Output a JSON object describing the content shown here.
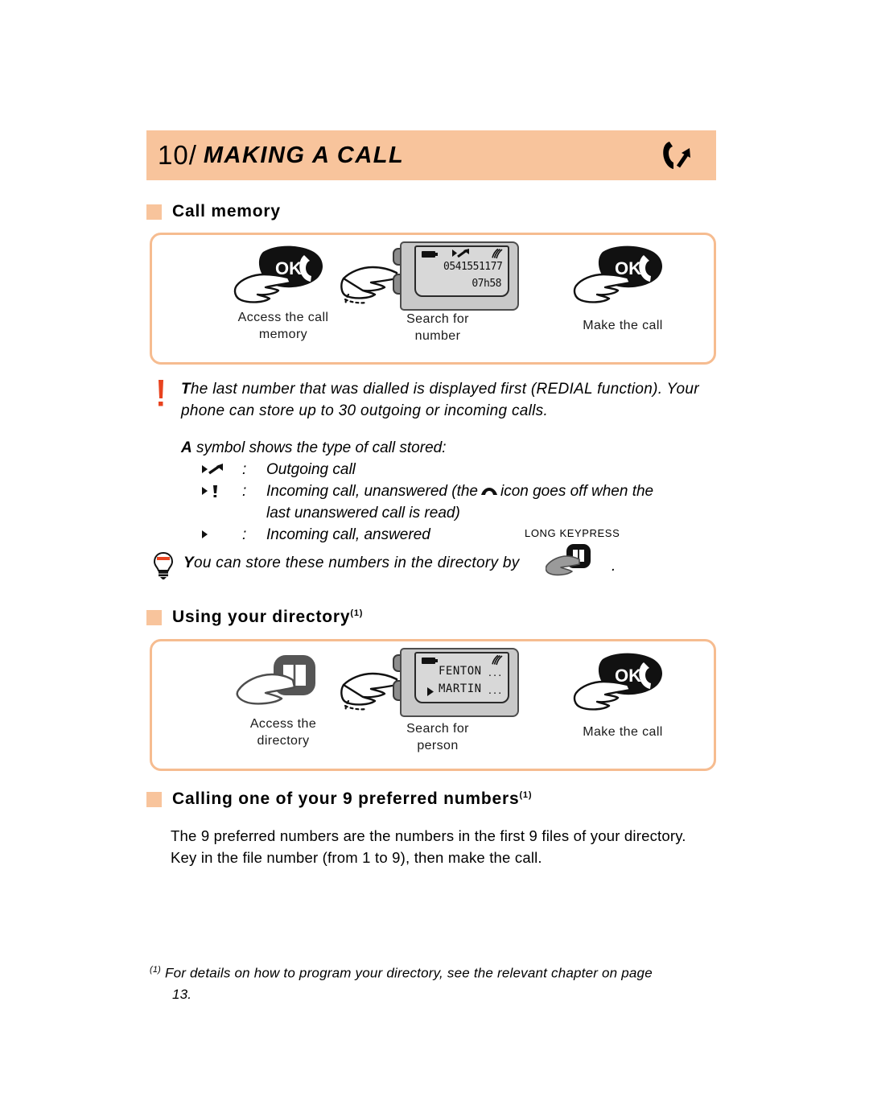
{
  "header": {
    "number": "10/",
    "title": "MAKING A CALL",
    "icon": "phone-outgoing-call-icon"
  },
  "sections": {
    "call_memory": {
      "heading": "Call memory",
      "steps": [
        {
          "caption_line1": "Access the call",
          "caption_line2": "memory",
          "icon": "hand-pressing-ok-key-icon"
        },
        {
          "caption_line1": "Search for",
          "caption_line2": "number",
          "icon": "hand-pressing-navigation-key-icon"
        },
        {
          "caption_line1": "Make the call",
          "caption_line2": "",
          "icon": "hand-pressing-ok-key-icon"
        }
      ],
      "phone_screen": {
        "number": "0541551177",
        "time": "07h58",
        "call_type_symbol": "outgoing-call-arrow-icon"
      }
    },
    "directory": {
      "heading": "Using your directory",
      "heading_footnote": "(1)",
      "steps": [
        {
          "caption_line1": "Access the",
          "caption_line2": "directory",
          "icon": "hand-pressing-directory-key-icon"
        },
        {
          "caption_line1": "Search for",
          "caption_line2": "person",
          "icon": "hand-pressing-navigation-key-icon"
        },
        {
          "caption_line1": "Make the call",
          "caption_line2": "",
          "icon": "hand-pressing-ok-key-icon"
        }
      ],
      "phone_screen": {
        "entry1": "FENTON",
        "entry1_dots": "...",
        "entry2": "MARTIN",
        "entry2_dots": "...",
        "selected_marker": "selection-triangle-icon"
      }
    },
    "preferred": {
      "heading": "Calling one of your 9 preferred numbers",
      "heading_footnote": "(1)",
      "body_line1": "The 9 preferred numbers are the numbers in the first 9 files of your directory.",
      "body_line2": "Key in the file number (from 1 to 9), then make the call."
    }
  },
  "warning": {
    "icon": "exclamation-warning-icon",
    "lead": "T",
    "line1_rest": "he last number that was dialled is displayed first (REDIAL function). Your",
    "line2": "phone can store up to 30 outgoing or incoming calls."
  },
  "symbols": {
    "intro_lead": "A",
    "intro_rest": " symbol shows the type of call stored:",
    "rows": [
      {
        "glyph": "outgoing-call-arrow-icon",
        "colon": ":",
        "text": "Outgoing call"
      },
      {
        "glyph": "incoming-unanswered-exclamation-icon",
        "colon": ":",
        "text_before": "Incoming call, unanswered (the",
        "inline_icon": "handset-hook-icon",
        "text_after": "icon goes off when the",
        "text_line2": "last unanswered call is read)"
      },
      {
        "glyph": "incoming-answered-triangle-icon",
        "colon": ":",
        "text": "Incoming call, answered"
      }
    ]
  },
  "tip": {
    "icon": "lightbulb-tip-icon",
    "lead": "Y",
    "text_rest": "ou can store these numbers in the directory by",
    "key_icon": "hand-pressing-directory-key-icon",
    "key_label": "LONG KEYPRESS",
    "trailing": "."
  },
  "footnote": {
    "mark": "(1)",
    "line1": "For details on how to program your directory, see the relevant chapter on page",
    "line2": "13."
  },
  "colors": {
    "accent": "#f8c49c",
    "box_border": "#f6bc90",
    "warning": "#e8431f"
  }
}
